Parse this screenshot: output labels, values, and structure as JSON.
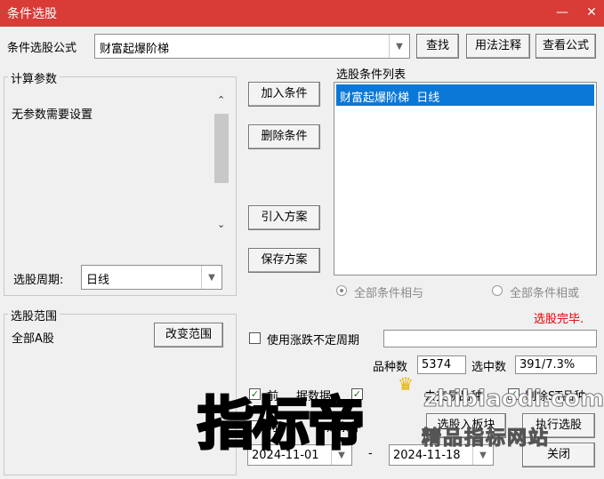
{
  "window": {
    "title": "条件选股",
    "minimize_icon": "—",
    "close_icon": "✕"
  },
  "formula_row": {
    "label": "条件选股公式",
    "value": "财富起爆阶梯",
    "find_button": "查找",
    "usage_button": "用法注释",
    "view_button": "查看公式"
  },
  "params": {
    "group_label": "计算参数",
    "message": "无参数需要设置",
    "period_label": "选股周期:",
    "period_value": "日线"
  },
  "actions": {
    "add": "加入条件",
    "delete": "删除条件",
    "import": "引入方案",
    "save": "保存方案"
  },
  "condition_list": {
    "label": "选股条件列表",
    "items": [
      "财富起爆阶梯  日线"
    ]
  },
  "logic": {
    "and_label": "全部条件相与",
    "or_label": "全部条件相或"
  },
  "status": {
    "text": "选股完毕.",
    "color": "#e00000"
  },
  "range": {
    "group_label": "选股范围",
    "value": "全部A股",
    "change_button": "改变范围"
  },
  "uncertain_period": {
    "label": "使用涨跌不定周期",
    "value": ""
  },
  "counts": {
    "total_label": "品种数",
    "total_value": "5374",
    "selected_label": "选中数",
    "selected_value": "391/7.3%"
  },
  "options": {
    "opt1": "前",
    "opt1_tail": "据数据",
    "opt2_tail": "去交易品种",
    "opt3": "剔除ST品种",
    "time_label": "时",
    "time_tail": "定条件"
  },
  "dates": {
    "start": "2024-11-01",
    "separator": "-",
    "end": "2024-11-18"
  },
  "bottom_buttons": {
    "to_block": "选股入板块",
    "execute": "执行选股",
    "close": "关闭"
  },
  "watermark": {
    "main": "指标帝",
    "url": "zhibiaodi.com",
    "tagline": "精品指标网站"
  },
  "colors": {
    "title_bar": "#d93b36",
    "selection": "#0a78d7"
  }
}
